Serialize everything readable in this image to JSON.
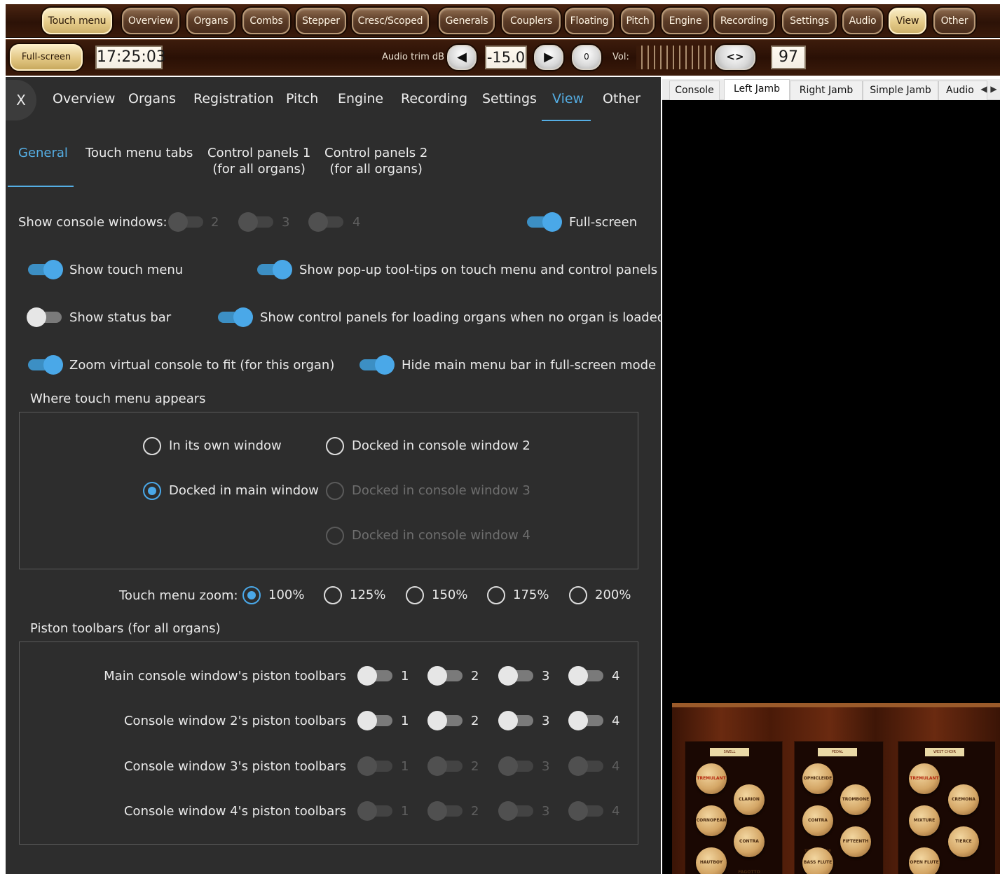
{
  "topbar": {
    "buttons": [
      {
        "label": "Touch menu",
        "active": true
      },
      {
        "label": "Overview",
        "active": false
      },
      {
        "label": "Organs",
        "active": false
      },
      {
        "label": "Combs",
        "active": false
      },
      {
        "label": "Stepper",
        "active": false
      },
      {
        "label": "Cresc/Scoped",
        "active": false
      },
      {
        "label": "Generals",
        "active": false
      },
      {
        "label": "Couplers",
        "active": false
      },
      {
        "label": "Floating",
        "active": false
      },
      {
        "label": "Pitch",
        "active": false
      },
      {
        "label": "Engine",
        "active": false
      },
      {
        "label": "Recording",
        "active": false
      },
      {
        "label": "Settings",
        "active": false
      },
      {
        "label": "Audio",
        "active": false
      },
      {
        "label": "View",
        "active": true
      },
      {
        "label": "Other",
        "active": false
      }
    ]
  },
  "toolbar2": {
    "fullscreen_label": "Full-screen",
    "clock": "17:25:03",
    "audio_trim_label": "Audio trim dB",
    "audio_trim_value": "-15.0",
    "reset_label": "0",
    "vol_label": "Vol:",
    "vol_value": "97",
    "arrows_label": "<>"
  },
  "panel": {
    "close_label": "X",
    "main_tabs": [
      "Overview",
      "Organs",
      "Registration",
      "Pitch",
      "Engine",
      "Recording",
      "Settings",
      "View",
      "Other"
    ],
    "main_tab_active": "View",
    "sub_tabs": [
      {
        "line1": "General",
        "line2": ""
      },
      {
        "line1": "Touch menu tabs",
        "line2": ""
      },
      {
        "line1": "Control panels 1",
        "line2": "(for all organs)"
      },
      {
        "line1": "Control panels 2",
        "line2": "(for all organs)"
      }
    ],
    "sub_tab_active": "General",
    "show_console_windows_label": "Show console windows:",
    "console_windows": [
      {
        "num": "2",
        "state": "disabled"
      },
      {
        "num": "3",
        "state": "disabled"
      },
      {
        "num": "4",
        "state": "disabled"
      }
    ],
    "fullscreen_toggle": {
      "label": "Full-screen",
      "on": true
    },
    "toggles": [
      {
        "label": "Show touch menu",
        "on": true
      },
      {
        "label": "Show pop-up tool-tips on touch menu and control panels",
        "on": true
      },
      {
        "label": "Show status bar",
        "on": false
      },
      {
        "label": "Show control panels for loading organs when no organ is loaded",
        "on": true
      },
      {
        "label": "Zoom virtual console to fit (for this organ)",
        "on": true
      },
      {
        "label": "Hide main menu bar in full-screen mode",
        "on": true
      }
    ],
    "where_touch_menu_title": "Where touch menu appears",
    "where_options": [
      {
        "label": "In its own window",
        "selected": false,
        "enabled": true
      },
      {
        "label": "Docked in console window 2",
        "selected": false,
        "enabled": true
      },
      {
        "label": "Docked in main window",
        "selected": true,
        "enabled": true
      },
      {
        "label": "Docked in console window 3",
        "selected": false,
        "enabled": false
      },
      {
        "label": "Docked in console window 4",
        "selected": false,
        "enabled": false
      }
    ],
    "zoom_label": "Touch menu zoom:",
    "zoom_options": [
      {
        "label": "100%",
        "selected": true
      },
      {
        "label": "125%",
        "selected": false
      },
      {
        "label": "150%",
        "selected": false
      },
      {
        "label": "175%",
        "selected": false
      },
      {
        "label": "200%",
        "selected": false
      }
    ],
    "piston_title": "Piston toolbars (for all organs)",
    "piston_rows": [
      {
        "label": "Main console window's piston toolbars",
        "enabled": true,
        "nums": [
          "1",
          "2",
          "3",
          "4"
        ]
      },
      {
        "label": "Console window 2's piston toolbars",
        "enabled": true,
        "nums": [
          "1",
          "2",
          "3",
          "4"
        ]
      },
      {
        "label": "Console window 3's piston toolbars",
        "enabled": false,
        "nums": [
          "1",
          "2",
          "3",
          "4"
        ]
      },
      {
        "label": "Console window 4's piston toolbars",
        "enabled": false,
        "nums": [
          "1",
          "2",
          "3",
          "4"
        ]
      }
    ]
  },
  "console": {
    "tabs": [
      "Console",
      "Left Jamb",
      "Right Jamb",
      "Simple Jamb",
      "Audio"
    ],
    "active_tab": "Left Jamb",
    "jamb_labels": [
      "SWELL",
      "PEDAL",
      "WEST CHOIR"
    ],
    "knobs": [
      "TREMULANT",
      "CLARION",
      "CORNOPEAN",
      "CONTRA FAGOTTO",
      "HAUTBOY",
      "OPHICLEIDE",
      "TROMBONE",
      "CONTRA TROMBONE",
      "FIFTEENTH",
      "BASS FLUTE",
      "TREMULANT",
      "CREMONA",
      "MIXTURE",
      "TIERCE",
      "OPEN FLUTE"
    ]
  },
  "colors": {
    "accent": "#4aa8e8",
    "panel_bg": "#2d2d2d",
    "wood_dark": "#2c1207",
    "button_cream": "#e6cc8a"
  }
}
